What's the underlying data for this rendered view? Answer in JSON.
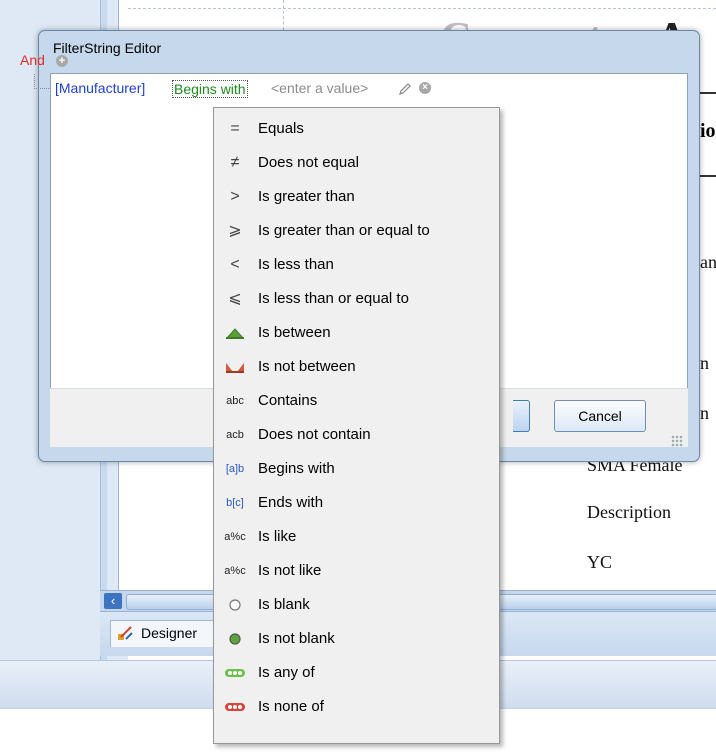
{
  "background": {
    "heading_faded": "Connector",
    "heading_dark": "A",
    "subheading": "io",
    "fragments": [
      "an",
      "n",
      "n",
      "SMA Female",
      "Description",
      "YC"
    ],
    "designer_tab": "Designer"
  },
  "dialog": {
    "title": "FilterString Editor",
    "tree": {
      "root_operator": "And",
      "condition": {
        "field": "[Manufacturer]",
        "operator": "Begins with",
        "value_placeholder": "<enter a value>"
      }
    },
    "cancel_label": "Cancel"
  },
  "menu": {
    "items": [
      {
        "icon": "=",
        "icon_name": "equals-icon",
        "label": "Equals"
      },
      {
        "icon": "≠",
        "icon_name": "not-equal-icon",
        "label": "Does not equal"
      },
      {
        "icon": ">",
        "icon_name": "greater-than-icon",
        "label": "Is greater than"
      },
      {
        "icon": "⩾",
        "icon_name": "greater-or-equal-icon",
        "label": "Is greater than or equal to"
      },
      {
        "icon": "<",
        "icon_name": "less-than-icon",
        "label": "Is less than"
      },
      {
        "icon": "⩽",
        "icon_name": "less-or-equal-icon",
        "label": "Is less than or equal to"
      },
      {
        "icon": "▲",
        "icon_name": "between-icon",
        "label": "Is between"
      },
      {
        "icon": "◣◢",
        "icon_name": "not-between-icon",
        "label": "Is not between"
      },
      {
        "icon": "abc",
        "icon_name": "contains-icon",
        "label": "Contains"
      },
      {
        "icon": "acb",
        "icon_name": "does-not-contain-icon",
        "label": "Does not contain"
      },
      {
        "icon": "[a]b",
        "icon_name": "begins-with-icon",
        "label": "Begins with"
      },
      {
        "icon": "b[c]",
        "icon_name": "ends-with-icon",
        "label": "Ends with"
      },
      {
        "icon": "a%c",
        "icon_name": "like-icon",
        "label": "Is like"
      },
      {
        "icon": "a%c",
        "icon_name": "not-like-icon",
        "label": "Is not like"
      },
      {
        "icon": "○",
        "icon_name": "blank-icon",
        "label": "Is blank"
      },
      {
        "icon": "●",
        "icon_name": "not-blank-icon",
        "label": "Is not blank"
      },
      {
        "icon": "ooo",
        "icon_name": "any-of-icon",
        "label": "Is any of"
      },
      {
        "icon": "ooo",
        "icon_name": "none-of-icon",
        "label": "Is none of"
      }
    ]
  },
  "colors": {
    "and_red": "#e02b2b",
    "field_blue": "#1f3fd8",
    "operator_green": "#1d8a1d",
    "placeholder_gray": "#8c8c8c"
  }
}
